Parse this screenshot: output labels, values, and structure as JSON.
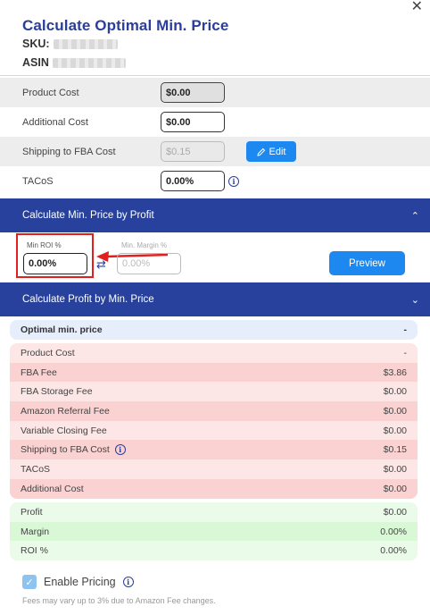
{
  "header": {
    "title": "Calculate Optimal Min. Price",
    "sku_label": "SKU:",
    "asin_label": "ASIN"
  },
  "inputs": [
    {
      "label": "Product Cost",
      "value": "$0.00"
    },
    {
      "label": "Additional Cost",
      "value": "$0.00"
    },
    {
      "label": "Shipping to FBA Cost",
      "value": "$0.15"
    },
    {
      "label": "TACoS",
      "value": "0.00%"
    }
  ],
  "edit_button": "Edit",
  "profit_section": {
    "title": "Calculate Min. Price by Profit",
    "min_roi_label": "Min ROI %",
    "min_roi_value": "0.00%",
    "min_margin_label": "Min. Margin %",
    "min_margin_value": "0.00%",
    "preview_button": "Preview"
  },
  "price_section": {
    "title": "Calculate Profit by Min. Price"
  },
  "summary": {
    "title": "Optimal min. price",
    "value": "-"
  },
  "costs": [
    {
      "label": "Product Cost",
      "value": "-"
    },
    {
      "label": "FBA Fee",
      "value": "$3.86"
    },
    {
      "label": "FBA Storage Fee",
      "value": "$0.00"
    },
    {
      "label": "Amazon Referral Fee",
      "value": "$0.00"
    },
    {
      "label": "Variable Closing Fee",
      "value": "$0.00"
    },
    {
      "label": "Shipping to FBA Cost",
      "value": "$0.15"
    },
    {
      "label": "TACoS",
      "value": "$0.00"
    },
    {
      "label": "Additional Cost",
      "value": "$0.00"
    }
  ],
  "profits": [
    {
      "label": "Profit",
      "value": "$0.00"
    },
    {
      "label": "Margin",
      "value": "0.00%"
    },
    {
      "label": "ROI %",
      "value": "0.00%"
    }
  ],
  "enable_pricing": "Enable Pricing",
  "note": "Fees may vary up to 3% due to Amazon Fee changes.",
  "colors": {
    "title": "#2a3e9b",
    "section_bar": "#27419c",
    "button": "#1c88f0",
    "highlight": "#e0201f"
  }
}
